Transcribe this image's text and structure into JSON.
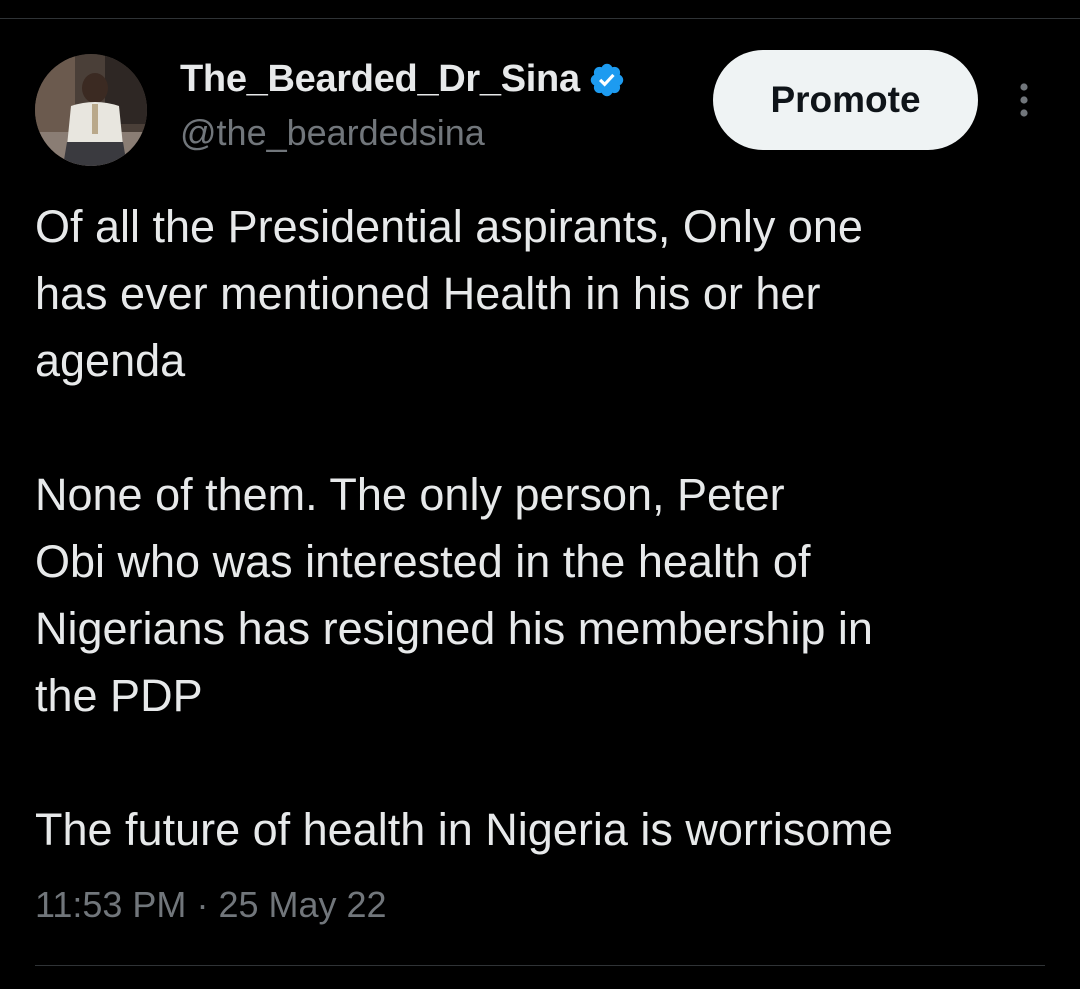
{
  "tweet": {
    "author": {
      "display_name": "The_Bearded_Dr_Sina",
      "handle": "@the_beardedsina",
      "verified": true,
      "avatar_icon": "profile-photo"
    },
    "promote_label": "Promote",
    "more_icon": "vertical-ellipsis-icon",
    "paragraphs": [
      [
        "Of all the Presidential aspirants, Only one",
        "has ever mentioned Health in his or her",
        "agenda"
      ],
      [
        "None of them. The only person, Peter",
        "Obi who was interested in the health of",
        "Nigerians has resigned his membership in",
        "the PDP"
      ],
      [
        "The future of health in Nigeria is worrisome"
      ]
    ],
    "time": "11:53 PM",
    "separator": "·",
    "date": "25 May 22"
  },
  "colors": {
    "background": "#000000",
    "primary_text": "#e7e9ea",
    "secondary_text": "#71767b",
    "verified_blue": "#1d9bf0",
    "button_bg": "#eff3f4",
    "divider": "#2f3336"
  }
}
